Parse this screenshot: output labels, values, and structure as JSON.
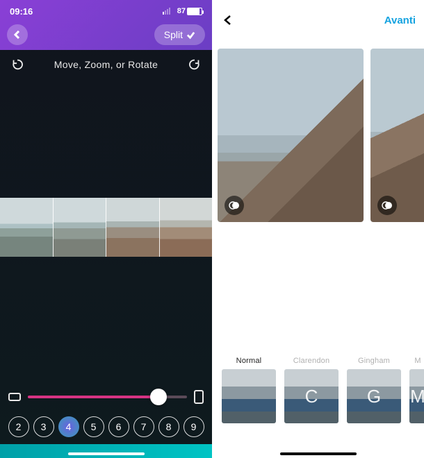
{
  "left": {
    "status": {
      "time": "09:16",
      "battery_text": "87"
    },
    "nav": {
      "split_label": "Split"
    },
    "toolbar": {
      "hint": "Move, Zoom, or Rotate"
    },
    "counts": [
      "2",
      "3",
      "4",
      "5",
      "6",
      "7",
      "8",
      "9"
    ],
    "selected_count_index": 2
  },
  "right": {
    "nav": {
      "next_label": "Avanti"
    },
    "filters": [
      {
        "name": "Normal",
        "letter": ""
      },
      {
        "name": "Clarendon",
        "letter": "C"
      },
      {
        "name": "Gingham",
        "letter": "G"
      },
      {
        "name": "M",
        "letter": "M"
      }
    ],
    "active_filter_index": 0
  }
}
